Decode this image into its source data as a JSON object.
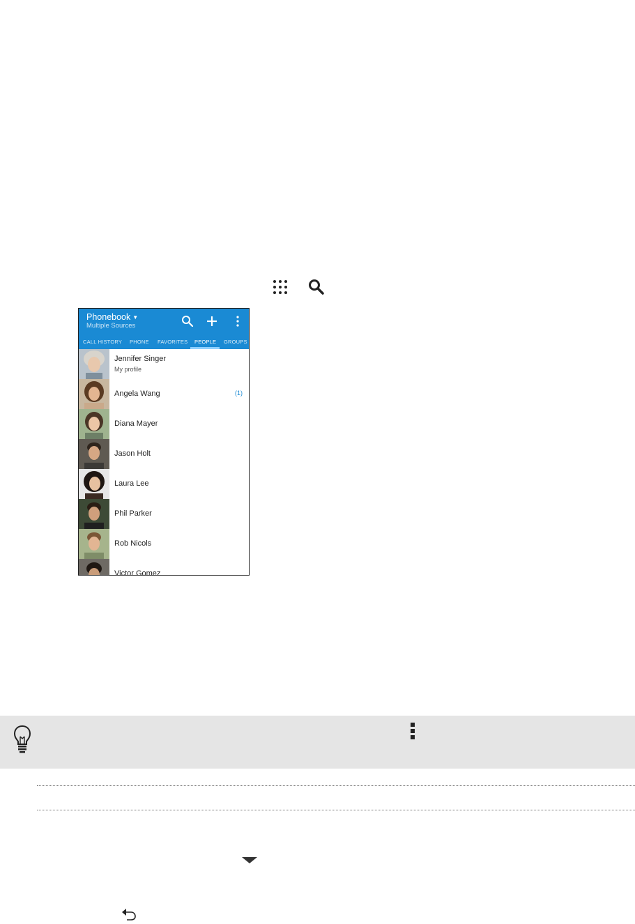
{
  "phone_screenshot": {
    "app_title": "Phonebook",
    "app_subtitle": "Multiple Sources",
    "tabs": [
      "CALL HISTORY",
      "PHONE",
      "FAVORITES",
      "PEOPLE",
      "GROUPS"
    ],
    "active_tab": "PEOPLE",
    "accent_color": "#1a8ad4",
    "contacts": [
      {
        "name": "Jennifer Singer",
        "subtitle": "My profile"
      },
      {
        "name": "Angela Wang",
        "badge": "(1)"
      },
      {
        "name": "Diana Mayer"
      },
      {
        "name": "Jason Holt"
      },
      {
        "name": "Laura Lee"
      },
      {
        "name": "Phil Parker"
      },
      {
        "name": "Rob Nicols"
      },
      {
        "name": "Victor Gomez"
      }
    ]
  },
  "icons": [
    "apps-icon",
    "search-icon",
    "lightbulb-tip-icon",
    "more-icon",
    "down-arrow-icon",
    "back-icon"
  ]
}
